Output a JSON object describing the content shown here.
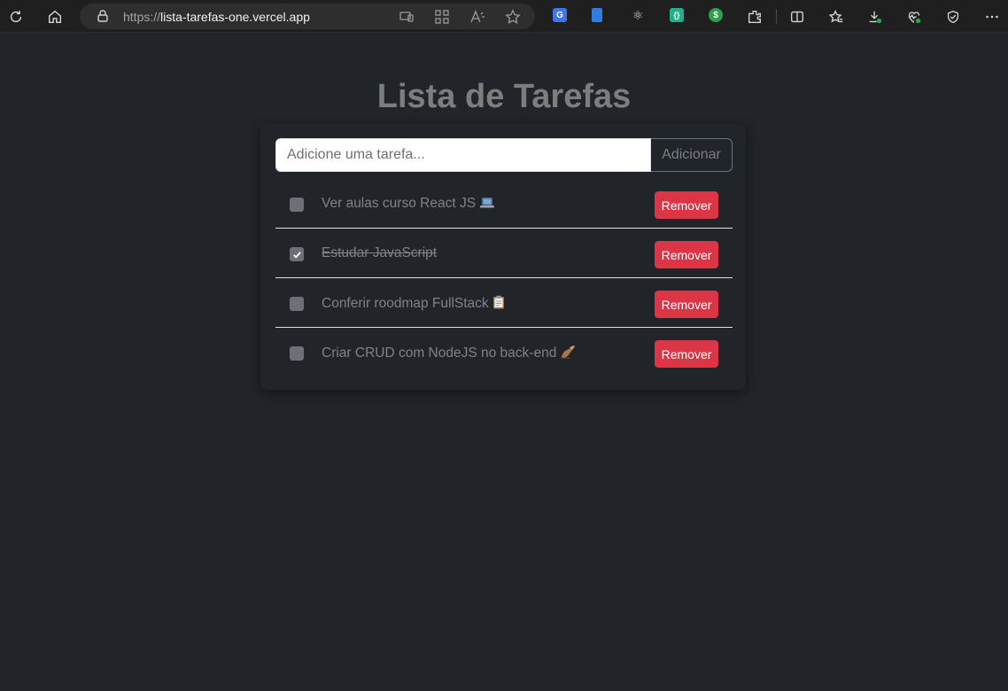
{
  "browser": {
    "url_protocol": "https://",
    "url_host": "lista-tarefas-one.vercel.app",
    "ext_colors": {
      "translate": "#3b78e7",
      "notes": "#2f7de1",
      "react": "#d4d4d4",
      "code": "#20b28d",
      "dollar": "#2fa04c"
    }
  },
  "app": {
    "title": "Lista de Tarefas",
    "input_placeholder": "Adicione uma tarefa...",
    "input_value": "",
    "add_label": "Adicionar",
    "remove_label": "Remover",
    "accent_danger": "#dc3545"
  },
  "tasks": [
    {
      "text": "Ver aulas curso React JS",
      "emoji": "laptop-icon",
      "completed": false
    },
    {
      "text": "Estudar JavaScript",
      "emoji": "",
      "completed": true
    },
    {
      "text": "Conferir roodmap FullStack",
      "emoji": "clipboard-icon",
      "completed": false
    },
    {
      "text": "Criar CRUD com NodeJS no back-end",
      "emoji": "writing-hand-icon",
      "completed": false
    }
  ]
}
